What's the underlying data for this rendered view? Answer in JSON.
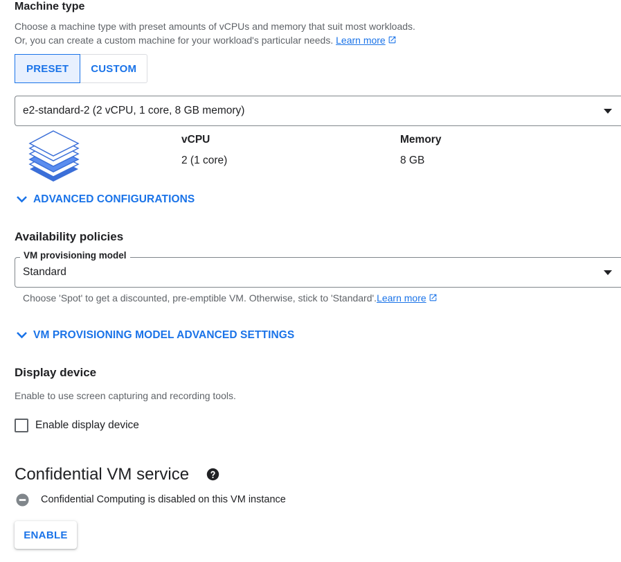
{
  "machine_type": {
    "title": "Machine type",
    "desc_line1": "Choose a machine type with preset amounts of vCPUs and memory that suit most workloads.",
    "desc_line2": "Or, you can create a custom machine for your workload's particular needs.",
    "learn_more": "Learn more",
    "tabs": [
      {
        "label": "PRESET",
        "active": true
      },
      {
        "label": "CUSTOM",
        "active": false
      }
    ],
    "selected": "e2-standard-2 (2 vCPU, 1 core, 8 GB memory)",
    "vcpu_label": "vCPU",
    "vcpu_value": "2 (1 core)",
    "memory_label": "Memory",
    "memory_value": "8 GB",
    "advanced": "ADVANCED CONFIGURATIONS"
  },
  "availability": {
    "title": "Availability policies",
    "field_label": "VM provisioning model",
    "value": "Standard",
    "hint": "Choose 'Spot' to get a discounted, pre-emptible VM. Otherwise, stick to 'Standard'.",
    "learn_more": "Learn more",
    "advanced": "VM PROVISIONING MODEL ADVANCED SETTINGS"
  },
  "display_device": {
    "title": "Display device",
    "desc": "Enable to use screen capturing and recording tools.",
    "checkbox_label": "Enable display device",
    "checked": false
  },
  "confidential": {
    "title": "Confidential VM service",
    "status": "Confidential Computing is disabled on this VM instance",
    "enable_button": "ENABLE"
  },
  "colors": {
    "accent": "#1a73e8",
    "text": "#202124",
    "secondary_text": "#5f6368",
    "selected_bg": "#e8f0fe"
  }
}
